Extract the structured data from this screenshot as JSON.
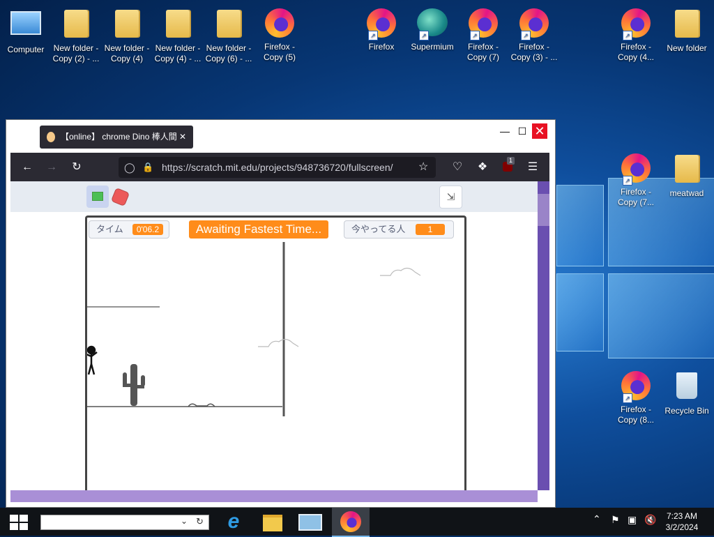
{
  "desktop": {
    "icons": [
      {
        "label": "Computer",
        "type": "computer"
      },
      {
        "label": "New folder - Copy (2) - ...",
        "type": "folder"
      },
      {
        "label": "New folder - Copy (4)",
        "type": "folder"
      },
      {
        "label": "New folder - Copy (4) - ...",
        "type": "folder"
      },
      {
        "label": "New folder - Copy (6) - ...",
        "type": "folder"
      },
      {
        "label": "Firefox - Copy (5)",
        "type": "firefox"
      },
      {
        "label": "Firefox",
        "type": "firefox"
      },
      {
        "label": "Supermium",
        "type": "supermium"
      },
      {
        "label": "Firefox - Copy (7)",
        "type": "firefox"
      },
      {
        "label": "Firefox - Copy (3) - ...",
        "type": "firefox"
      },
      {
        "label": "Firefox - Copy (4...",
        "type": "firefox"
      },
      {
        "label": "New folder",
        "type": "folder"
      },
      {
        "label": "Firefox - Copy (7...",
        "type": "firefox"
      },
      {
        "label": "meatwad",
        "type": "folder"
      },
      {
        "label": "Firefox - Copy (8...",
        "type": "firefox"
      },
      {
        "label": "Recycle Bin",
        "type": "bin"
      }
    ]
  },
  "browser": {
    "tab_title": "【online】 chrome Dino 棒人間",
    "url": "https://scratch.mit.edu/projects/948736720/fullscreen/",
    "url_host_highlight": "mit.edu",
    "extension_badge": "1",
    "window_controls": {
      "minimize": "—",
      "maximize": "☐",
      "close": "✕"
    }
  },
  "scratch": {
    "timer_label": "タイム",
    "timer_value": "0'06.2",
    "awaiting_text": "Awaiting Fastest Time...",
    "players_label": "今やってる人",
    "players_value": "1"
  },
  "taskbar": {
    "time": "7:23 AM",
    "date": "3/2/2024"
  },
  "colors": {
    "accent_orange": "#ff8c1a",
    "firefox_toolbar": "#2b2a33",
    "close_red": "#e81123",
    "scrollbar_purple": "#6a4fb0"
  }
}
